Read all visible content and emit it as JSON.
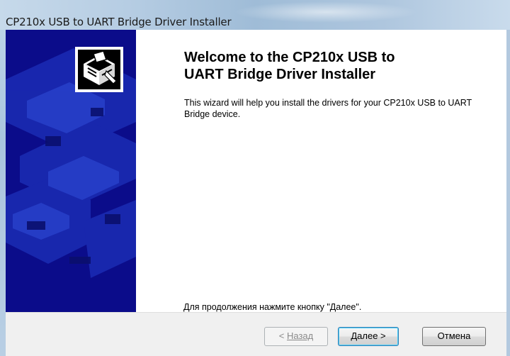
{
  "window": {
    "title": "CP210x USB to UART Bridge Driver Installer"
  },
  "wizard": {
    "icon": "installer-box-icon",
    "heading_line1": "Welcome to the CP210x USB to",
    "heading_line2": "UART Bridge Driver Installer",
    "description": "This wizard will help you install the drivers for your CP210x USB to UART Bridge device.",
    "continue_note": "Для продолжения нажмите кнопку \"Далее\"."
  },
  "buttons": {
    "back_prefix": "< ",
    "back_label": "Назад",
    "next_label": "Далее >",
    "cancel_label": "Отмена"
  },
  "colors": {
    "banner": "#0b0c8a",
    "button_bar": "#f0f0f0",
    "default_button_border": "#3c7fb1"
  }
}
